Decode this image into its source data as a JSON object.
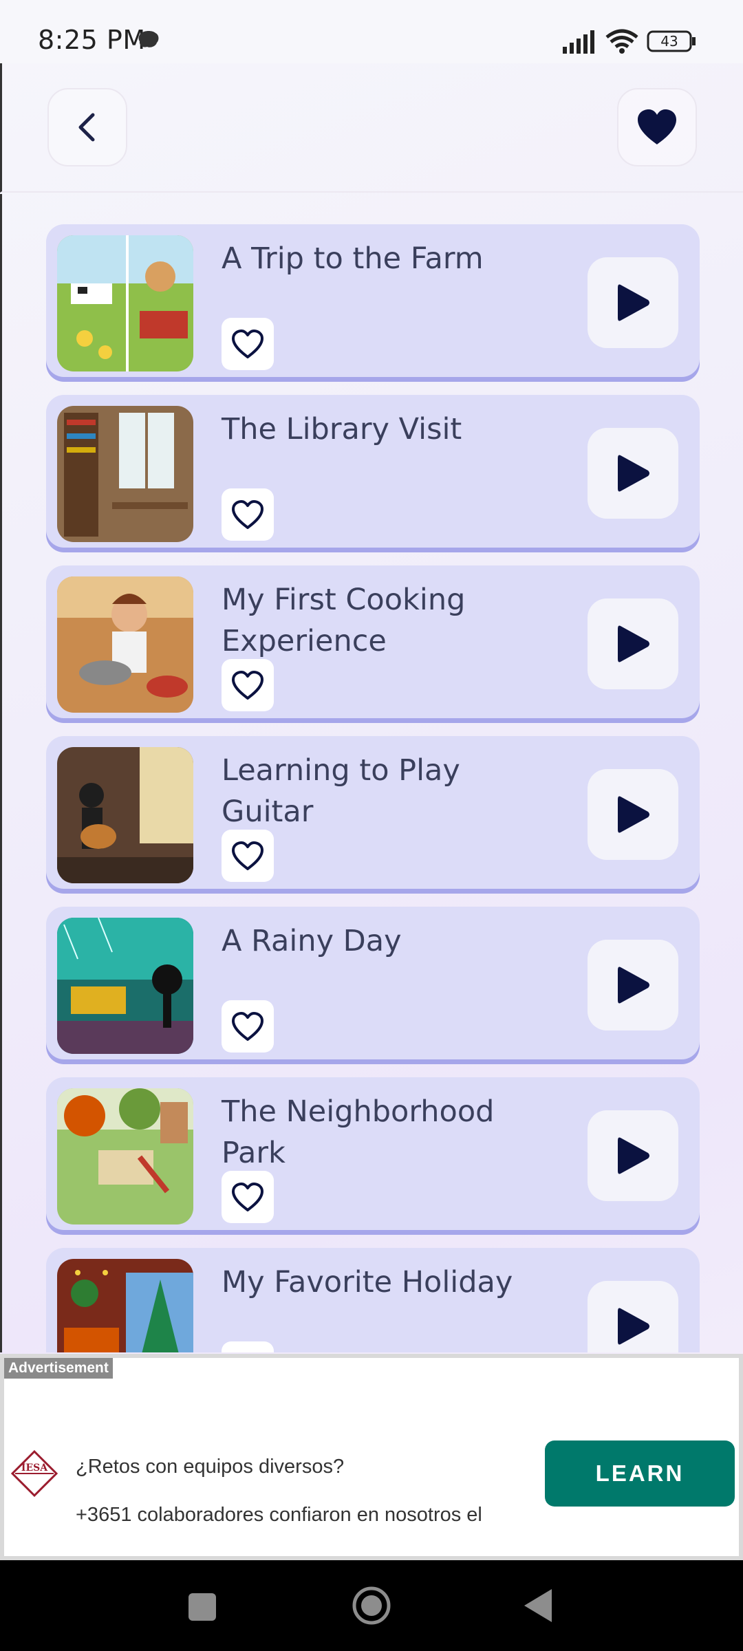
{
  "status_bar": {
    "time": "8:25 PM",
    "battery": "43"
  },
  "header": {
    "back_icon": "chevron-left-icon",
    "favorite_icon": "heart-filled-icon"
  },
  "stories": [
    {
      "title": "A Trip to the Farm",
      "thumb": "farm-illustration"
    },
    {
      "title": "The Library Visit",
      "thumb": "library-illustration"
    },
    {
      "title": "My First Cooking Experience",
      "thumb": "cooking-illustration"
    },
    {
      "title": "Learning to Play Guitar",
      "thumb": "guitar-illustration"
    },
    {
      "title": "A Rainy Day",
      "thumb": "rainy-day-illustration"
    },
    {
      "title": "The Neighborhood Park",
      "thumb": "park-illustration"
    },
    {
      "title": "My Favorite Holiday",
      "thumb": "holiday-illustration"
    }
  ],
  "ad": {
    "label": "Advertisement",
    "logo_text": "IESA",
    "headline": "¿Retos con equipos diversos?",
    "subtext": "+3651 colaboradores confiaron en nosotros el",
    "cta": "LEARN"
  },
  "colors": {
    "card": "#dcdcf8",
    "card_shadow": "#a6a6ea",
    "icon_dark": "#0b1240",
    "cta_green": "#00796b"
  }
}
